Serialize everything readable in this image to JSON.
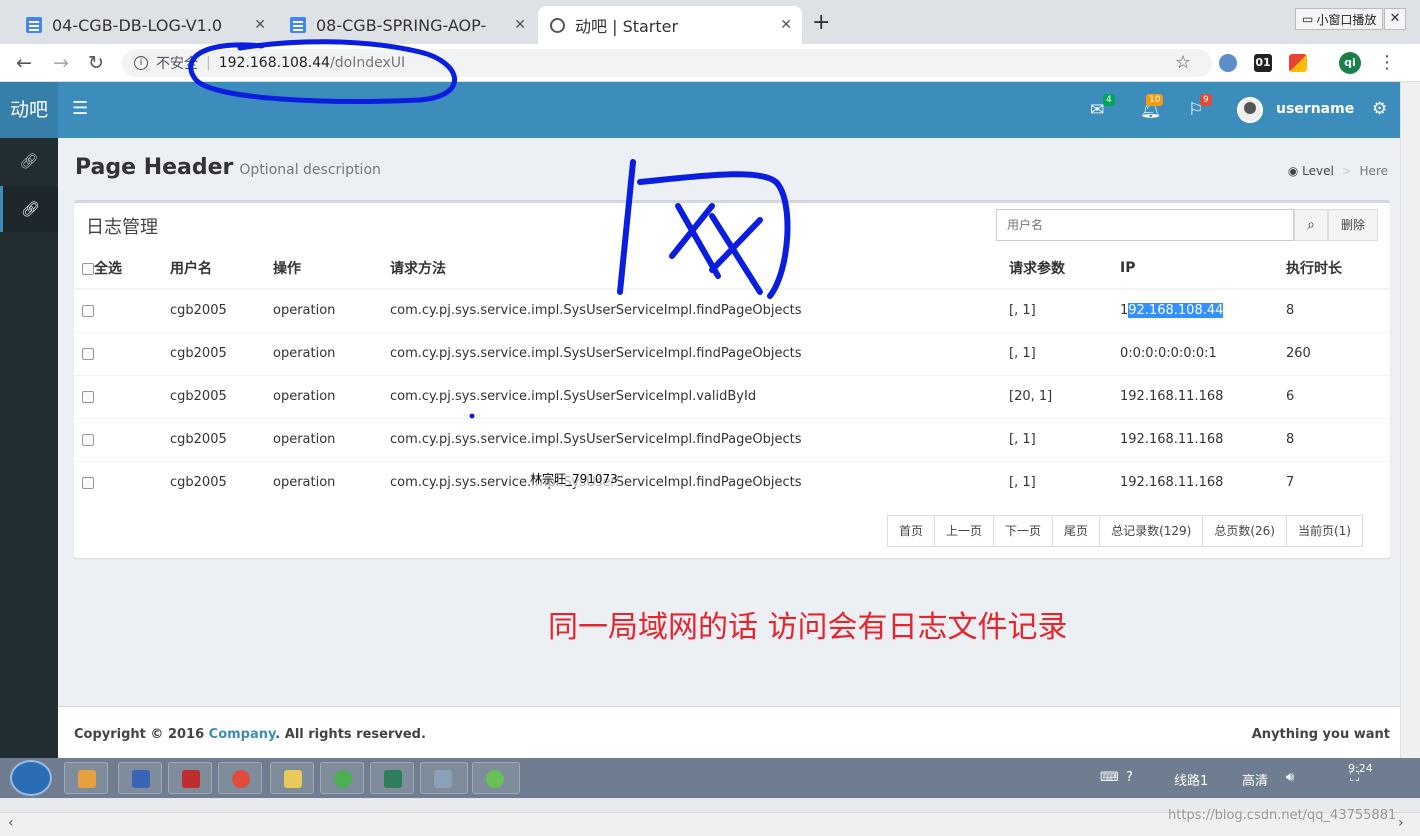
{
  "browser": {
    "tabs": [
      {
        "title": "04-CGB-DB-LOG-V1.0"
      },
      {
        "title": "08-CGB-SPRING-AOP-"
      },
      {
        "title": "动吧 | Starter"
      }
    ],
    "mini_window_label": "小窗口播放",
    "address": {
      "insecure_label": "不安全",
      "host": "192.168.108.44",
      "path": "/doIndexUI"
    },
    "extensions": [
      {
        "label": "",
        "color": "#5b8fc9"
      },
      {
        "label": "01",
        "color": "#222222"
      },
      {
        "label": "",
        "color": "#f4b400"
      },
      {
        "label": "qi",
        "color": "#1a7f4b"
      }
    ]
  },
  "app": {
    "logo": "动吧",
    "header": {
      "mail_count": "4",
      "notify_count": "10",
      "flag_count": "9",
      "username": "username"
    },
    "page": {
      "title": "Page Header",
      "description": "Optional description",
      "breadcrumb_level": "Level",
      "breadcrumb_here": "Here"
    },
    "box": {
      "title": "日志管理",
      "search_placeholder": "用户名",
      "delete_label": "删除"
    },
    "table": {
      "headers": [
        "全选",
        "用户名",
        "操作",
        "请求方法",
        "请求参数",
        "IP",
        "执行时长"
      ],
      "rows": [
        {
          "user": "cgb2005",
          "op": "operation",
          "method": "com.cy.pj.sys.service.impl.SysUserServiceImpl.findPageObjects",
          "params": "[, 1]",
          "ip_prefix": "1",
          "ip_selected": "92.168.108.44",
          "time": "8"
        },
        {
          "user": "cgb2005",
          "op": "operation",
          "method": "com.cy.pj.sys.service.impl.SysUserServiceImpl.findPageObjects",
          "params": "[, 1]",
          "ip_prefix": "0:0:0:0:0:0:0:1",
          "ip_selected": "",
          "time": "260"
        },
        {
          "user": "cgb2005",
          "op": "operation",
          "method": "com.cy.pj.sys.service.impl.SysUserServiceImpl.validById",
          "params": "[20, 1]",
          "ip_prefix": "192.168.11.168",
          "ip_selected": "",
          "time": "6"
        },
        {
          "user": "cgb2005",
          "op": "operation",
          "method": "com.cy.pj.sys.service.impl.SysUserServiceImpl.findPageObjects",
          "params": "[, 1]",
          "ip_prefix": "192.168.11.168",
          "ip_selected": "",
          "time": "8"
        },
        {
          "user": "cgb2005",
          "op": "operation",
          "method": "com.cy.pj.sys.service.impl.SysUserServiceImpl.findPageObjects",
          "params": "[, 1]",
          "ip_prefix": "192.168.11.168",
          "ip_selected": "",
          "time": "7"
        }
      ]
    },
    "pager": [
      "首页",
      "上一页",
      "下一页",
      "尾页",
      "总记录数(129)",
      "总页数(26)",
      "当前页(1)"
    ],
    "annotation": "同一局域网的话 访问会有日志文件记录",
    "watermark": "林宗旺_791073",
    "footer": {
      "copyright_prefix": "Copyright © 2016 ",
      "company": "Company",
      "copyright_suffix": ". All rights reserved.",
      "right_text": "Anything you want"
    }
  },
  "taskbar": {
    "tray_route": "线路1",
    "tray_quality": "高清",
    "clock": "9:24"
  },
  "csdn_url": "https://blog.csdn.net/qq_43755881",
  "colors": {
    "header_blue": "#3c8dbc",
    "sidebar_dark": "#222d32",
    "annotation_red": "#e8242b",
    "pen_blue": "#0a1ee0"
  }
}
